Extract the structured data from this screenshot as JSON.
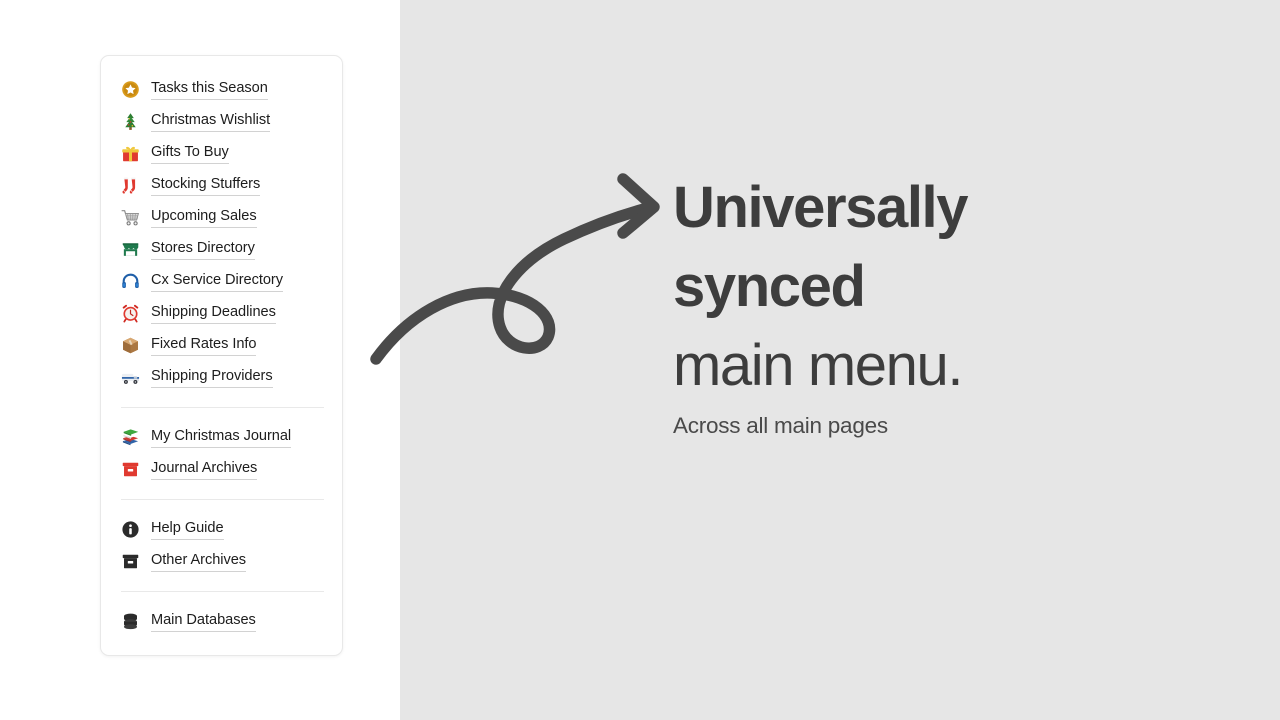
{
  "sidebar": {
    "groups": [
      {
        "name": "primary",
        "items": [
          {
            "label": "Tasks this Season",
            "icon": "star-medal-icon"
          },
          {
            "label": "Christmas Wishlist",
            "icon": "christmas-tree-icon"
          },
          {
            "label": "Gifts To Buy",
            "icon": "gift-icon"
          },
          {
            "label": "Stocking Stuffers",
            "icon": "stocking-icon"
          },
          {
            "label": "Upcoming Sales",
            "icon": "shopping-cart-icon"
          },
          {
            "label": "Stores Directory",
            "icon": "storefront-icon"
          },
          {
            "label": "Cx Service Directory",
            "icon": "headphone-icon"
          },
          {
            "label": "Shipping Deadlines",
            "icon": "alarm-clock-icon"
          },
          {
            "label": "Fixed Rates Info",
            "icon": "package-box-icon"
          },
          {
            "label": "Shipping Providers",
            "icon": "delivery-truck-icon"
          }
        ]
      },
      {
        "name": "journal",
        "items": [
          {
            "label": "My Christmas Journal",
            "icon": "books-stack-icon"
          },
          {
            "label": "Journal Archives",
            "icon": "red-archive-box-icon"
          }
        ]
      },
      {
        "name": "support",
        "items": [
          {
            "label": "Help Guide",
            "icon": "info-circle-icon"
          },
          {
            "label": "Other Archives",
            "icon": "archive-box-icon"
          }
        ]
      },
      {
        "name": "data",
        "items": [
          {
            "label": "Main Databases",
            "icon": "database-icon"
          }
        ]
      }
    ]
  },
  "content": {
    "headline_line1": "Universally",
    "headline_line2": "synced",
    "headline_line3": "main menu.",
    "subtitle": "Across all main pages",
    "arrow": "curved-loop-arrow-icon"
  },
  "colors": {
    "panel_background": "#e6e6e6",
    "card_background": "#ffffff",
    "headline_text": "#3d3d3d",
    "subtitle_text": "#4a4a4a",
    "nav_text": "#1d1d1d",
    "arrow_stroke": "#4a4a4a",
    "underline": "#d2d2d2",
    "divider": "#e9e9e9"
  }
}
